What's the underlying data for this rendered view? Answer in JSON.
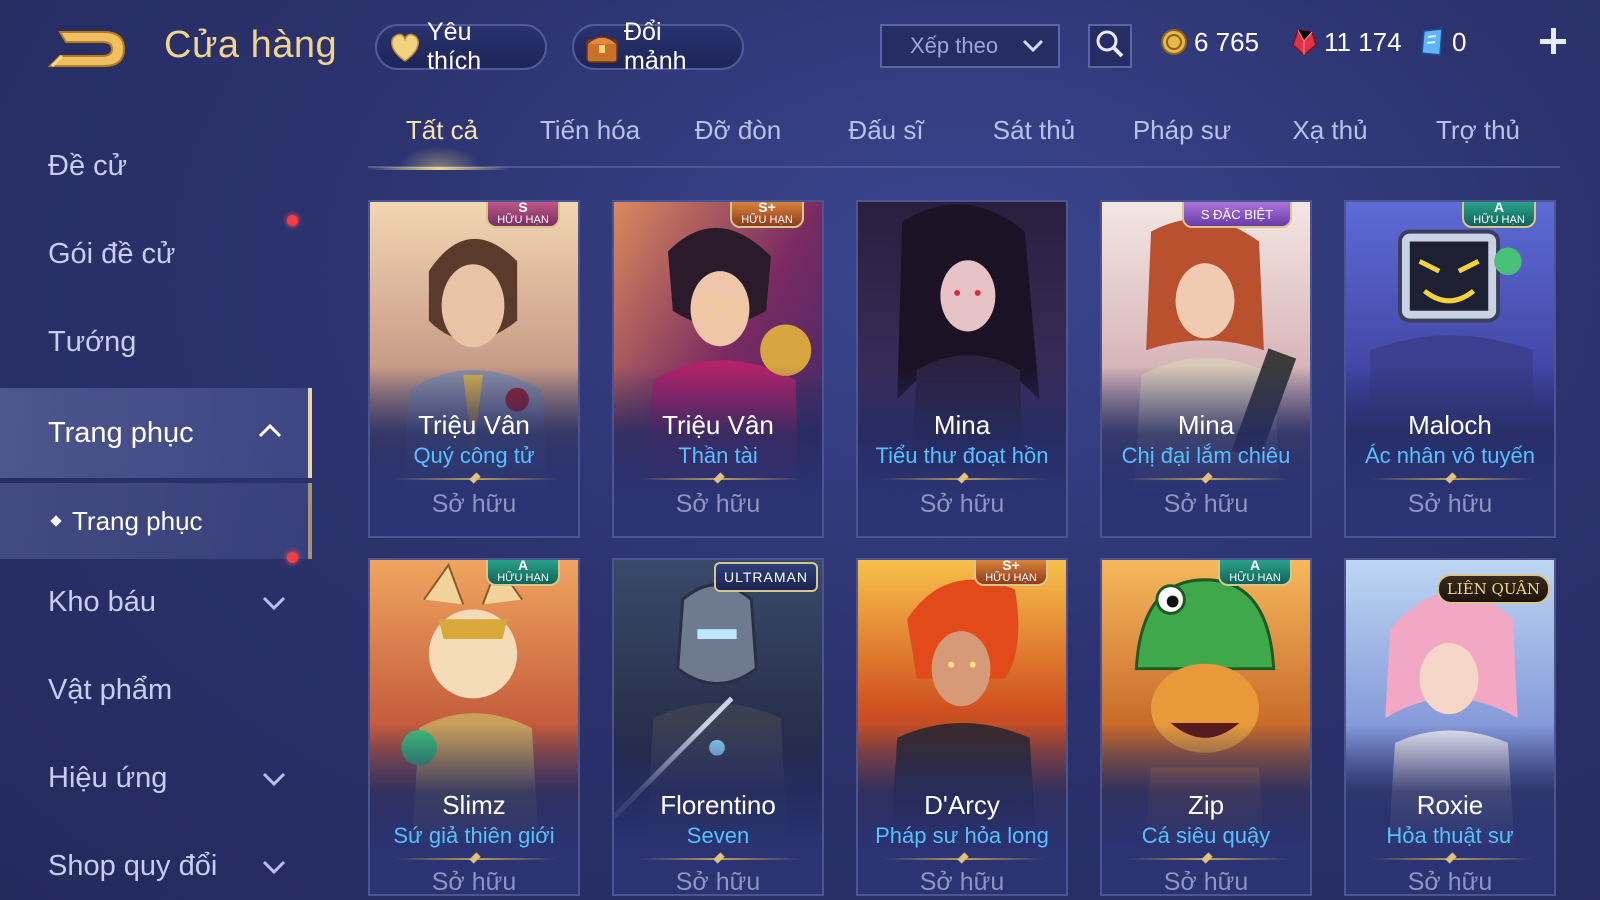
{
  "header": {
    "title": "Cửa hàng",
    "favorites_label": "Yêu thích",
    "exchange_label": "Đổi mảnh",
    "sort": {
      "label": "Xếp theo"
    },
    "currencies": [
      {
        "name": "gold",
        "value": "6 765",
        "icon": "gold-coin-icon"
      },
      {
        "name": "ruby",
        "value": "11 174",
        "icon": "ruby-gem-icon"
      },
      {
        "name": "voucher",
        "value": "0",
        "icon": "voucher-icon"
      }
    ]
  },
  "sidebar": {
    "items": [
      {
        "label": "Đề cử"
      },
      {
        "label": "Gói đề cử"
      },
      {
        "label": "Tướng"
      },
      {
        "label": "Trang phục"
      },
      {
        "label": "Kho báu"
      },
      {
        "label": "Vật phẩm"
      },
      {
        "label": "Hiệu ứng"
      },
      {
        "label": "Shop quy đổi"
      }
    ],
    "sub_item": {
      "label": "Trang phục"
    }
  },
  "tabs": [
    {
      "label": "Tất cả"
    },
    {
      "label": "Tiến hóa"
    },
    {
      "label": "Đỡ đòn"
    },
    {
      "label": "Đấu sĩ"
    },
    {
      "label": "Sát thủ"
    },
    {
      "label": "Pháp sư"
    },
    {
      "label": "Xạ thủ"
    },
    {
      "label": "Trợ thủ"
    }
  ],
  "cards": [
    {
      "hero": "Triệu Vân",
      "skin": "Quý công tử",
      "status": "Sở hữu",
      "badge_rank": "S",
      "badge_text": "HỮU HẠN"
    },
    {
      "hero": "Triệu Vân",
      "skin": "Thần tài",
      "status": "Sở hữu",
      "badge_rank": "S+",
      "badge_text": "HỮU HẠN"
    },
    {
      "hero": "Mina",
      "skin": "Tiểu thư đoạt hồn",
      "status": "Sở hữu"
    },
    {
      "hero": "Mina",
      "skin": "Chị đại lắm chiêu",
      "status": "Sở hữu",
      "badge_rank": "S",
      "badge_text": "ĐẶC BIỆT"
    },
    {
      "hero": "Maloch",
      "skin": "Ác nhân vô tuyến",
      "status": "Sở hữu",
      "badge_rank": "A",
      "badge_text": "HỮU HẠN"
    },
    {
      "hero": "Slimz",
      "skin": "Sứ giả thiên giới",
      "status": "Sở hữu",
      "badge_rank": "A",
      "badge_text": "HỮU HẠN"
    },
    {
      "hero": "Florentino",
      "skin": "Seven",
      "status": "Sở hữu",
      "badge_text": "ULTRAMAN"
    },
    {
      "hero": "D'Arcy",
      "skin": "Pháp sư hỏa long",
      "status": "Sở hữu",
      "badge_rank": "S+",
      "badge_text": "HỮU HẠN"
    },
    {
      "hero": "Zip",
      "skin": "Cá siêu quậy",
      "status": "Sở hữu",
      "badge_rank": "A",
      "badge_text": "HỮU HẠN"
    },
    {
      "hero": "Roxie",
      "skin": "Hỏa thuật sư",
      "status": "Sở hữu",
      "badge_text": "LIÊN QUÂN"
    }
  ]
}
